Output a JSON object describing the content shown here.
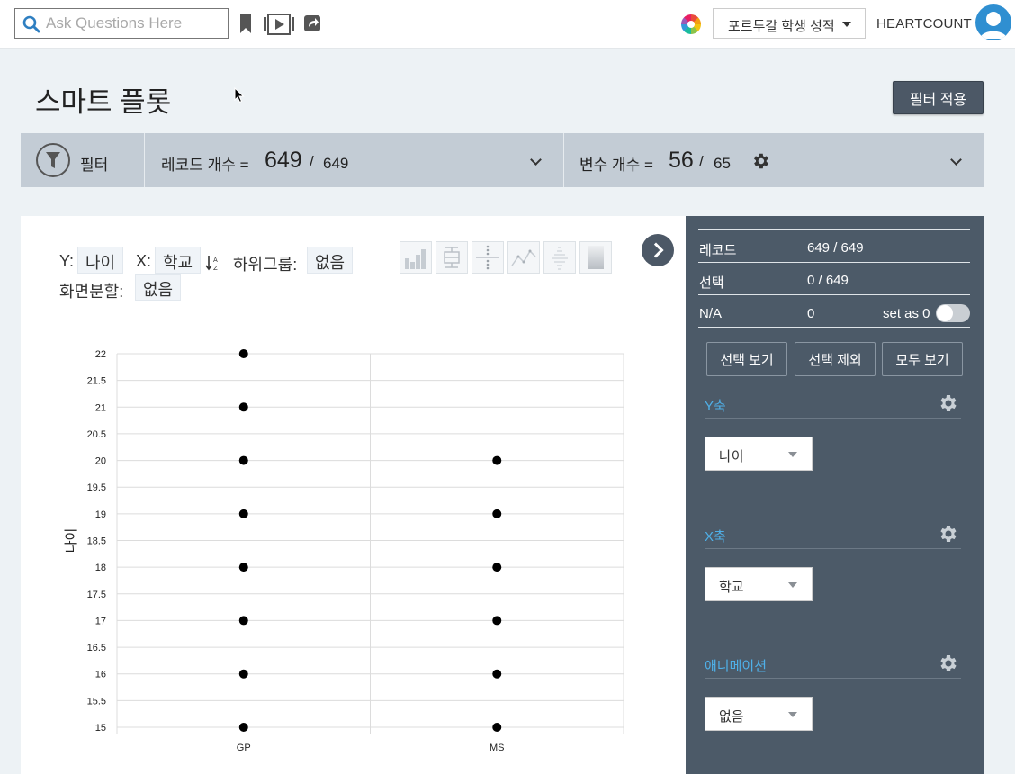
{
  "header": {
    "search_placeholder": "Ask Questions Here",
    "dataset": "포르투갈 학생 성적",
    "brand": "HEARTCOUNT"
  },
  "page": {
    "title": "스마트 플롯",
    "apply_filter_label": "필터 적용"
  },
  "filter_bar": {
    "filter_label": "필터",
    "records_label": "레코드 개수 =",
    "records_selected": "649",
    "records_sep": "/",
    "records_total": "649",
    "vars_label": "변수 개수 =",
    "vars_selected": "56",
    "vars_sep": "/",
    "vars_total": "65"
  },
  "controls": {
    "y_label": "Y:",
    "y_value": "나이",
    "x_label": "X:",
    "x_value": "학교",
    "subgroup_label": "하위그룹:",
    "subgroup_value": "없음",
    "split_label": "화면분할:",
    "split_value": "없음",
    "chart_types": [
      "bar-chart-icon",
      "boxplot-icon",
      "dot-strip-icon",
      "line-chart-icon",
      "distribution-icon",
      "heatmap-icon"
    ]
  },
  "side": {
    "records_k": "레코드",
    "records_v": "649 / 649",
    "selected_k": "선택",
    "selected_v": "0 / 649",
    "na_k": "N/A",
    "na_v": "0",
    "set_as_zero": "set as 0",
    "set_as_zero_on": false,
    "btn_show_selected": "선택 보기",
    "btn_exclude_selected": "선택 제외",
    "btn_show_all": "모두 보기",
    "y_axis_title": "Y축",
    "y_axis_value": "나이",
    "x_axis_title": "X축",
    "x_axis_value": "학교",
    "anim_title": "애니메이션",
    "anim_value": "없음"
  },
  "colors": {
    "side_bg": "#4c5a68",
    "accent_blue": "#4fb0e8",
    "filterbar_bg": "#c3ccd5",
    "button_dark": "#4c5866"
  },
  "chart_data": {
    "type": "scatter",
    "ylabel": "나이",
    "xlabel": "",
    "categories": [
      "GP",
      "MS"
    ],
    "ylim": [
      15,
      22
    ],
    "yticks": [
      15,
      15.5,
      16,
      16.5,
      17,
      17.5,
      18,
      18.5,
      19,
      19.5,
      20,
      20.5,
      21,
      21.5,
      22
    ],
    "series": [
      {
        "points": [
          {
            "x": "GP",
            "y": 22
          },
          {
            "x": "GP",
            "y": 21
          },
          {
            "x": "GP",
            "y": 20
          },
          {
            "x": "GP",
            "y": 19
          },
          {
            "x": "GP",
            "y": 18
          },
          {
            "x": "GP",
            "y": 17
          },
          {
            "x": "GP",
            "y": 16
          },
          {
            "x": "GP",
            "y": 15
          },
          {
            "x": "MS",
            "y": 20
          },
          {
            "x": "MS",
            "y": 19
          },
          {
            "x": "MS",
            "y": 18
          },
          {
            "x": "MS",
            "y": 17
          },
          {
            "x": "MS",
            "y": 16
          },
          {
            "x": "MS",
            "y": 15
          }
        ]
      }
    ],
    "grid": true
  }
}
